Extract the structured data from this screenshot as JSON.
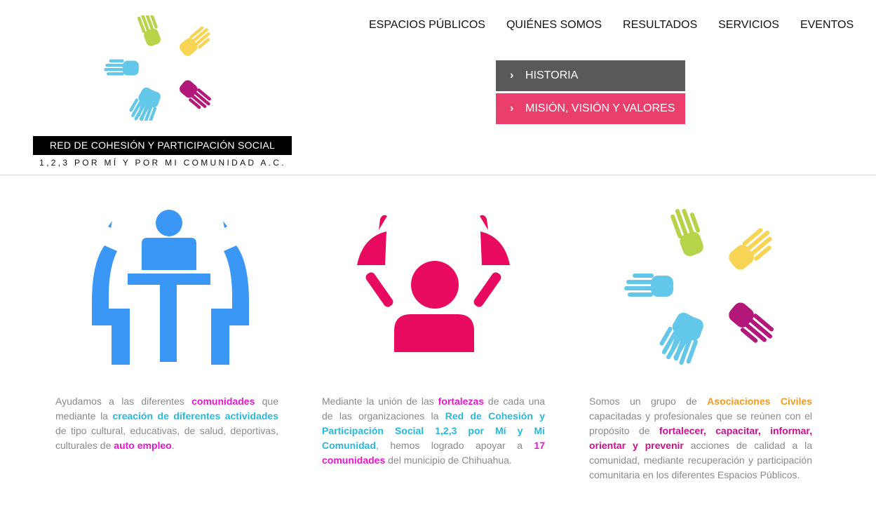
{
  "brand": {
    "bar_text": "RED DE COHESIÓN Y PARTICIPACIÓN SOCIAL",
    "sub_text": "1,2,3 POR MÍ Y POR MI COMUNIDAD A.C."
  },
  "nav": {
    "items": [
      "ESPACIOS PÚBLICOS",
      "QUIÉNES SOMOS",
      "RESULTADOS",
      "SERVICIOS",
      "EVENTOS"
    ]
  },
  "submenu": {
    "items": [
      "HISTORIA",
      "MISIÓN, VISIÓN Y VALORES"
    ]
  },
  "colors": {
    "blue_icon": "#3b97f5",
    "pink_icon": "#e80a5e",
    "submenu_gray": "#595959",
    "submenu_pink": "#ea3e6c",
    "hand_cyan": "#62c7e8",
    "hand_green": "#b6d44a",
    "hand_yellow": "#f7d453",
    "hand_magenta": "#b3177a"
  },
  "columns": [
    {
      "icon": "meeting-table-icon",
      "parts": [
        "Ayudamos a las diferentes ",
        "comunidades",
        " que mediante la ",
        "creación de diferentes actividades",
        " de tipo cultural, educativas, de salud, deportivas, culturales de ",
        "auto empleo",
        "."
      ]
    },
    {
      "icon": "group-people-icon",
      "parts": [
        "Mediante la unión de las ",
        "fortalezas",
        " de cada una de las organizaciones la ",
        "Red de Cohesión y Participación Social 1,2,3 por Mí y Mi Comunidad",
        ", hemos logrado apoyar a ",
        "17 comunidades",
        " del municipio de Chihuahua."
      ]
    },
    {
      "icon": "hands-circle-icon",
      "parts": [
        "Somos un grupo de ",
        "Asociaciones Civiles",
        " capacitadas y profesionales que se reúnen con el propósito de ",
        "fortalecer, capacitar, informar, orientar y prevenir",
        " acciones de calidad a la comunidad, mediante recuperación y participación comunitaria en los diferentes Espacios Públicos."
      ]
    }
  ]
}
